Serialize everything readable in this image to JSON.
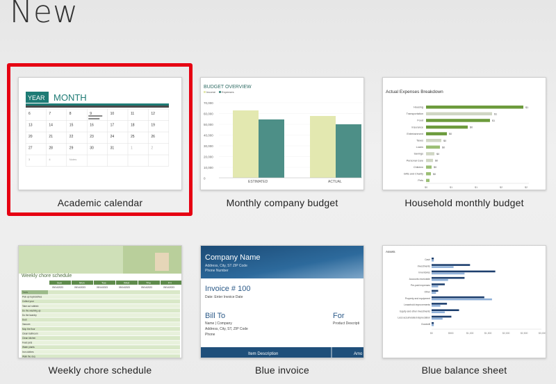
{
  "page": {
    "title": "New"
  },
  "templates": [
    {
      "label": "Academic calendar",
      "selected": true,
      "preview": {
        "badge": "YEAR",
        "heading": "MONTH",
        "weeks": [
          [
            "6",
            "7",
            "8",
            "9",
            "10",
            "11",
            "12"
          ],
          [
            "13",
            "14",
            "15",
            "16",
            "17",
            "18",
            "19"
          ],
          [
            "20",
            "21",
            "22",
            "23",
            "24",
            "25",
            "26"
          ],
          [
            "27",
            "28",
            "29",
            "30",
            "31",
            "1",
            "2"
          ]
        ],
        "extra_row": [
          "3",
          "4",
          "Notes"
        ],
        "accent": "#1e7b75"
      }
    },
    {
      "label": "Monthly company budget",
      "preview": {
        "title": "BUDGET OVERVIEW",
        "legend": [
          "Income",
          "Expenses"
        ],
        "y_ticks": [
          "70,000",
          "60,000",
          "50,000",
          "40,000",
          "30,000",
          "20,000",
          "10,000",
          "0"
        ],
        "categories": [
          "ESTIMATED",
          "ACTUAL"
        ],
        "colors": {
          "income": "#e3e8b0",
          "expenses": "#4d8f87"
        }
      }
    },
    {
      "label": "Household monthly budget",
      "preview": {
        "title": "Actual Expenses Breakdown",
        "rows": [
          "Housing",
          "Transportation",
          "Food",
          "Insurance",
          "Entertainment",
          "Taxes",
          "Loans",
          "Savings",
          "Personal Care",
          "Children",
          "Gifts and Charity",
          "Pets"
        ],
        "values_text": [
          "$1",
          "$1",
          "$1",
          "$0",
          "$0",
          "$0",
          "$0",
          "$0",
          "$0",
          "$0",
          "$0"
        ],
        "axis": [
          "$0",
          "$1",
          "$1",
          "$2",
          "$2"
        ],
        "colors": {
          "dark": "#6c9b3c",
          "light": "#cfd6c3",
          "mid": "#9bbf74"
        }
      }
    },
    {
      "label": "Weekly chore schedule",
      "preview": {
        "title": "Weekly chore schedule",
        "days": [
          "Sun",
          "Mon",
          "Tue",
          "Wed",
          "Thu",
          "Fri"
        ],
        "dates": [
          "09/14/2023",
          "09/14/2023",
          "09/14/2023",
          "09/14/2023",
          "09/14/2023",
          "09/14/2023"
        ],
        "chores": [
          "Tasks",
          "Pick up toys/clothes",
          "Collect your",
          "Take out rubbish",
          "Do the washing up",
          "Do the laundry",
          "Dust",
          "Vacuum",
          "Mop the floor",
          "Clean bathroom",
          "Clean kitchen",
          "Feed pets",
          "Water plants",
          "Iron clothes",
          "Walk the dog",
          "Tidy bedroom",
          "Make beds"
        ],
        "colors": {
          "header": "#5f8b4c",
          "band": "#d9e8c8"
        }
      }
    },
    {
      "label": "Blue invoice",
      "preview": {
        "company": "Company Name",
        "address": "Address, City, ST ZIP Code",
        "phone": "Phone Number",
        "invoice_no": "Invoice # 100",
        "invoice_date": "Date: Enter Invoice Date",
        "bill_to": "Bill To",
        "bill_name": "Name | Company",
        "bill_address": "Address, City, ST, ZIP Code",
        "bill_phone": "Phone",
        "for_label": "For",
        "for_value": "Product Descripti",
        "col_desc": "Item Description",
        "col_amount": "Amo",
        "colors": {
          "banner": "#1f4f7a",
          "accent": "#2c5a88"
        }
      }
    },
    {
      "label": "Blue balance sheet",
      "preview": {
        "title": "Assets",
        "rows": [
          "Cash",
          "Investments",
          "Inventories",
          "Accounts receivable",
          "Pre-paid expenses",
          "Other",
          "Property and equipment",
          "Leasehold improvements",
          "Equity and other investments",
          "Less accumulated depreciation",
          "Goodwill"
        ],
        "dark_values": [
          0.02,
          0.35,
          0.58,
          0.3,
          0.12,
          0.06,
          0.48,
          0.14,
          0.25,
          0.18,
          0.02
        ],
        "light_values": [
          0.02,
          0.2,
          0.3,
          0.15,
          0.06,
          0.04,
          0.55,
          0.08,
          0.12,
          0.1,
          0.02
        ],
        "axis": [
          "$0",
          "$500",
          "$1,000",
          "$1,500",
          "$2,000",
          "$2,500",
          "$3,000"
        ],
        "colors": {
          "dark": "#1d3f6e",
          "light": "#8fb0d8"
        }
      }
    }
  ]
}
